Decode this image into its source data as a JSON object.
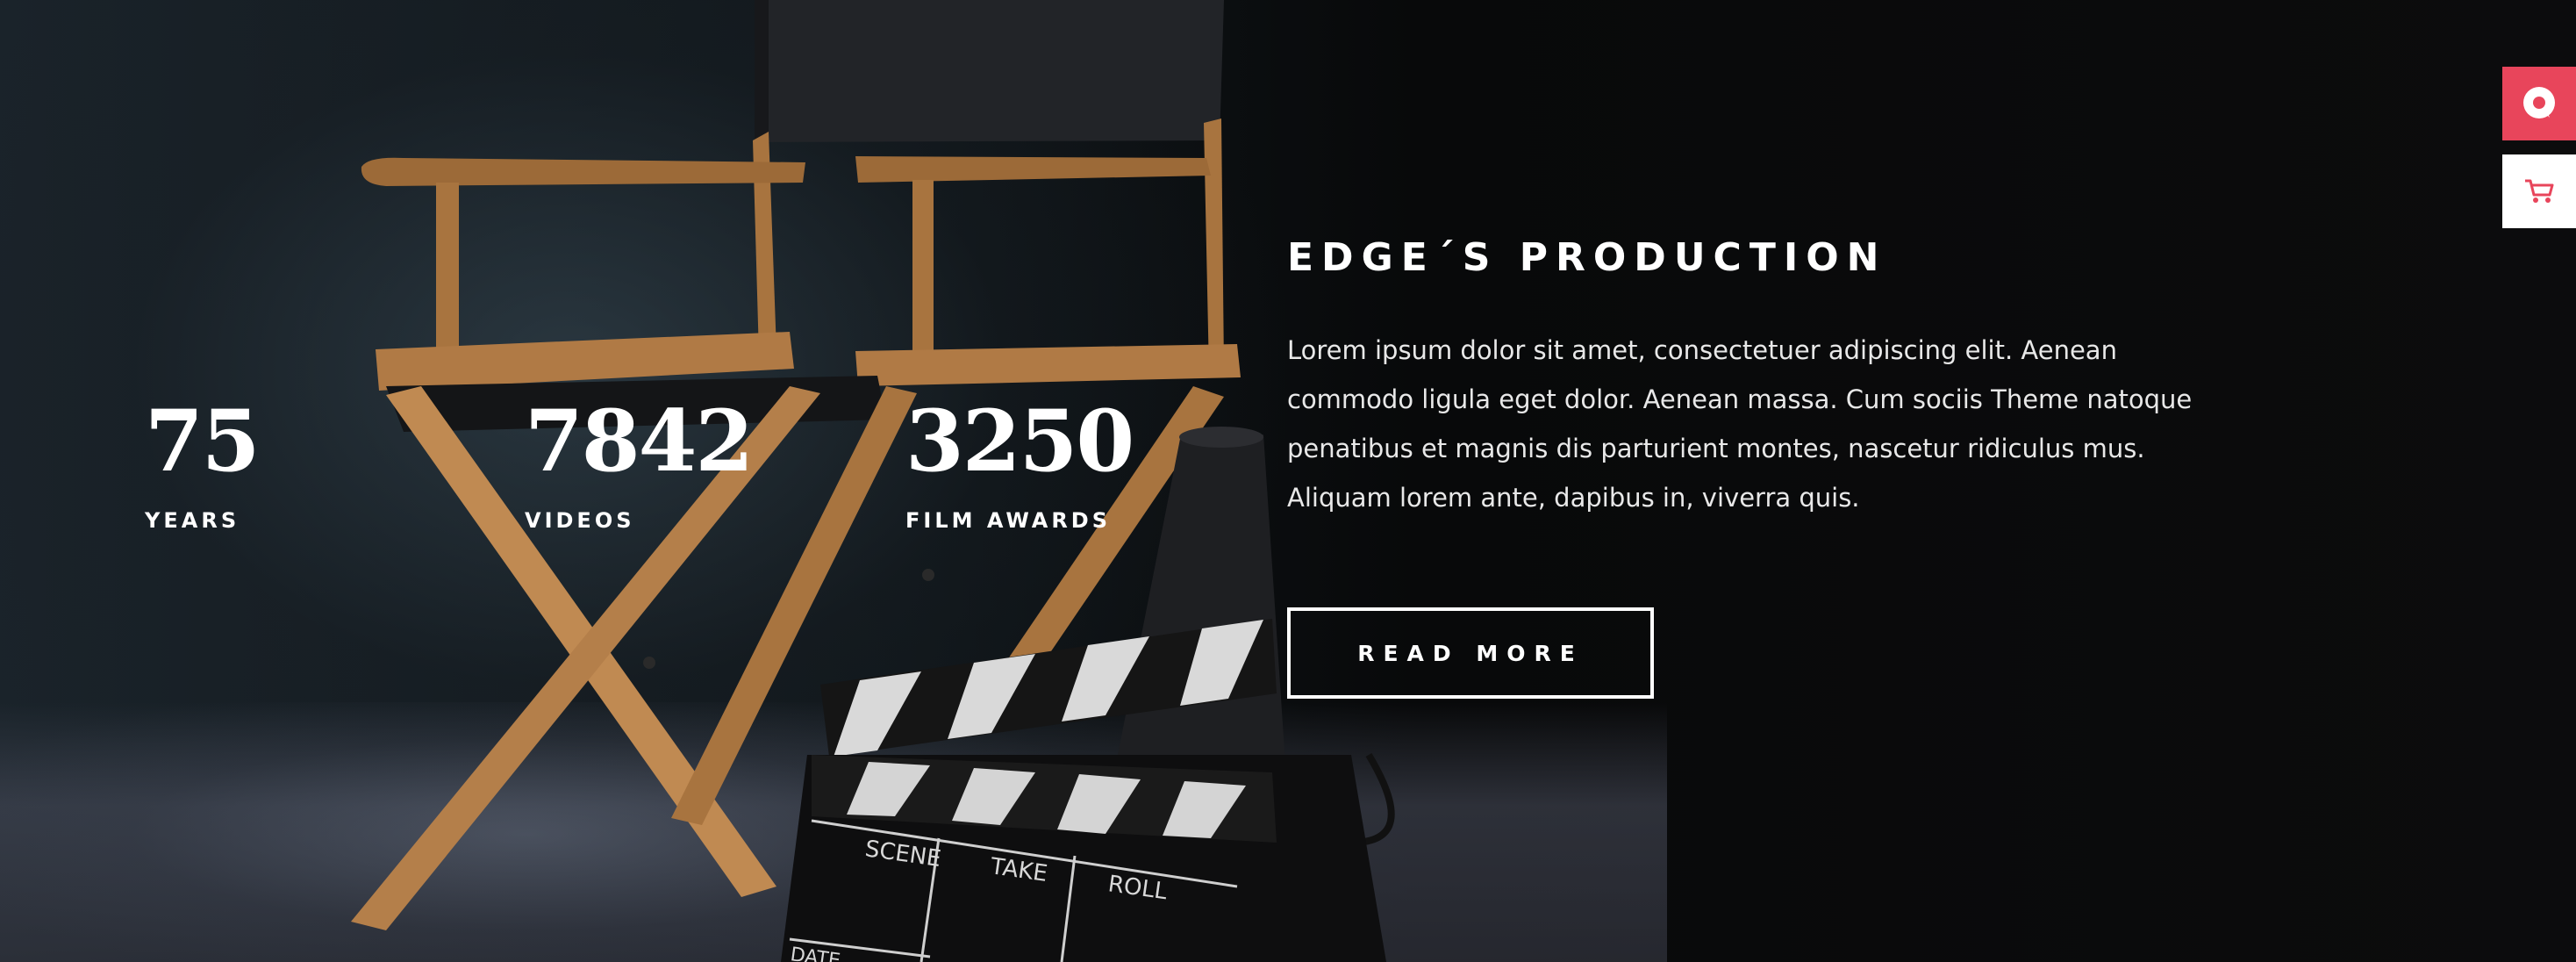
{
  "stats": [
    {
      "value": "75",
      "label": "YEARS"
    },
    {
      "value": "7842",
      "label": "VIDEOS"
    },
    {
      "value": "3250",
      "label": "FILM AWARDS"
    }
  ],
  "content": {
    "title": "EDGE´S PRODUCTION",
    "description": "Lorem ipsum dolor sit amet, consectetuer adipiscing elit. Aenean commodo ligula eget dolor. Aenean massa. Cum sociis Theme natoque penatibus et magnis dis parturient montes, nascetur ridiculus mus. Aliquam lorem ante, dapibus in, viverra quis.",
    "button_label": "READ MORE"
  },
  "clapperboard": {
    "scene": "SCENE",
    "take": "TAKE",
    "roll": "ROLL",
    "date": "DATE"
  },
  "side_buttons": {
    "chat_icon": "chat-bubble-icon",
    "cart_icon": "cart-icon"
  },
  "colors": {
    "accent": "#e8455b",
    "text": "#ffffff",
    "background": "#0b0b0c",
    "chair_wood": "#b07a45"
  }
}
